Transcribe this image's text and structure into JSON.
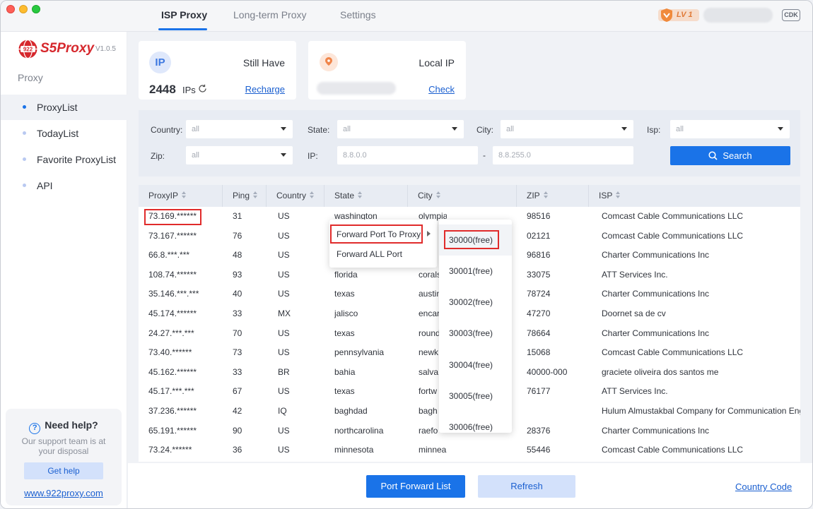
{
  "tabs": [
    {
      "label": "ISP Proxy",
      "active": true
    },
    {
      "label": "Long-term Proxy",
      "active": false
    },
    {
      "label": "Settings",
      "active": false
    }
  ],
  "header": {
    "level_badge": "LV 1",
    "cdk_label": "CDK"
  },
  "sidebar": {
    "brand": "S5Proxy",
    "version": "V1.0.5",
    "section_title": "Proxy",
    "items": [
      {
        "label": "ProxyList",
        "active": true
      },
      {
        "label": "TodayList",
        "active": false
      },
      {
        "label": "Favorite ProxyList",
        "active": false
      },
      {
        "label": "API",
        "active": false
      }
    ],
    "help": {
      "title": "Need help?",
      "text": "Our support team is at your disposal",
      "button": "Get help",
      "link": "www.922proxy.com"
    }
  },
  "ip_card": {
    "icon_text": "IP",
    "label": "Still Have",
    "count": "2448",
    "unit": "IPs",
    "link": "Recharge"
  },
  "local_card": {
    "label": "Local IP",
    "link": "Check"
  },
  "filters": {
    "country_label": "Country:",
    "country_value": "all",
    "state_label": "State:",
    "state_value": "all",
    "city_label": "City:",
    "city_value": "all",
    "isp_label": "Isp:",
    "isp_value": "all",
    "zip_label": "Zip:",
    "zip_value": "all",
    "ip_label": "IP:",
    "ip_from": "8.8.0.0",
    "ip_dash": "-",
    "ip_to": "8.8.255.0",
    "search_button": "Search"
  },
  "table": {
    "columns": [
      "ProxyIP",
      "Ping",
      "Country",
      "State",
      "City",
      "ZIP",
      "ISP"
    ],
    "rows": [
      [
        "73.169.******",
        "31",
        "US",
        "washington",
        "olympia",
        "98516",
        "Comcast Cable Communications LLC"
      ],
      [
        "73.167.******",
        "76",
        "US",
        "",
        "",
        "02121",
        "Comcast Cable Communications LLC"
      ],
      [
        "66.8.***.***",
        "48",
        "US",
        "",
        "",
        "96816",
        "Charter Communications Inc"
      ],
      [
        "108.74.******",
        "93",
        "US",
        "florida",
        "corals",
        "33075",
        "ATT Services Inc."
      ],
      [
        "35.146.***.***",
        "40",
        "US",
        "texas",
        "austin",
        "78724",
        "Charter Communications Inc"
      ],
      [
        "45.174.******",
        "33",
        "MX",
        "jalisco",
        "encar",
        "47270",
        "Doornet sa de cv"
      ],
      [
        "24.27.***.***",
        "70",
        "US",
        "texas",
        "round",
        "78664",
        "Charter Communications Inc"
      ],
      [
        "73.40.******",
        "73",
        "US",
        "pennsylvania",
        "newk",
        "15068",
        "Comcast Cable Communications LLC"
      ],
      [
        "45.162.******",
        "33",
        "BR",
        "bahia",
        "salva",
        "40000-000",
        "graciete oliveira dos santos me"
      ],
      [
        "45.17.***.***",
        "67",
        "US",
        "texas",
        "fortw",
        "76177",
        "ATT Services Inc."
      ],
      [
        "37.236.******",
        "42",
        "IQ",
        "baghdad",
        "bagh",
        "",
        "Hulum Almustakbal Company for Communication Eng"
      ],
      [
        "65.191.******",
        "90",
        "US",
        "northcarolina",
        "raefo",
        "28376",
        "Charter Communications Inc"
      ],
      [
        "73.24.******",
        "36",
        "US",
        "minnesota",
        "minneapolis",
        "55446",
        "Comcast Cable Communications LLC"
      ]
    ]
  },
  "context_menu": {
    "items": [
      "Forward Port To Proxy",
      "Forward ALL Port"
    ],
    "ports": [
      "30000(free)",
      "30001(free)",
      "30002(free)",
      "30003(free)",
      "30004(free)",
      "30005(free)",
      "30006(free)"
    ]
  },
  "footer": {
    "port_forward_button": "Port Forward List",
    "refresh_button": "Refresh",
    "country_link": "Country Code"
  },
  "colors": {
    "accent": "#1a73e8",
    "brand_red": "#d6282d",
    "highlight_red": "#e02b2b"
  }
}
